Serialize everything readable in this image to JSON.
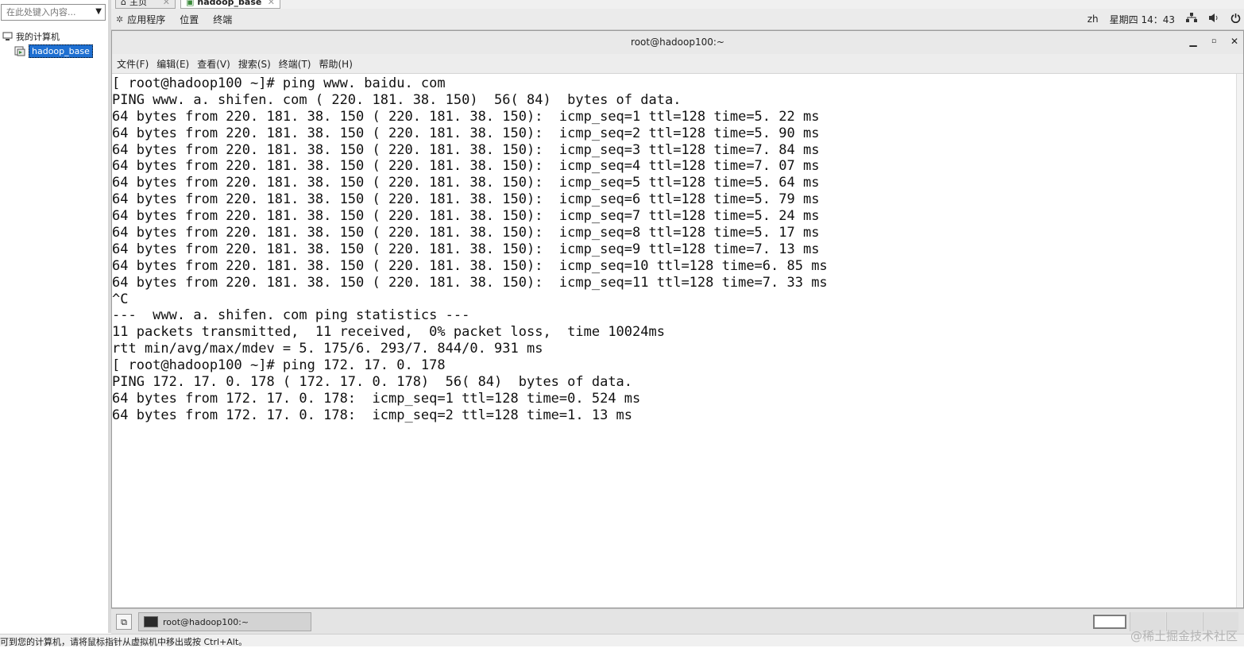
{
  "library": {
    "search_placeholder": "在此处键入内容...",
    "tree": [
      {
        "label": "我的计算机"
      },
      {
        "label": "hadoop_base"
      }
    ]
  },
  "vm_tabs": [
    {
      "label": "主页"
    },
    {
      "label": "hadoop_base"
    }
  ],
  "gnome_panel": {
    "applications": "应用程序",
    "places": "位置",
    "terminal": "终端",
    "input_method": "zh",
    "clock": "星期四 14：43",
    "icons": [
      "network-icon",
      "volume-icon",
      "power-icon"
    ]
  },
  "terminal": {
    "title": "root@hadoop100:~",
    "menu": [
      "文件(F)",
      "编辑(E)",
      "查看(V)",
      "搜索(S)",
      "终端(T)",
      "帮助(H)"
    ],
    "lines": [
      "[ root@hadoop100 ~]# ping www. baidu. com",
      "PING www. a. shifen. com ( 220. 181. 38. 150)  56( 84)  bytes of data.",
      "64 bytes from 220. 181. 38. 150 ( 220. 181. 38. 150):  icmp_seq=1 ttl=128 time=5. 22 ms",
      "64 bytes from 220. 181. 38. 150 ( 220. 181. 38. 150):  icmp_seq=2 ttl=128 time=5. 90 ms",
      "64 bytes from 220. 181. 38. 150 ( 220. 181. 38. 150):  icmp_seq=3 ttl=128 time=7. 84 ms",
      "64 bytes from 220. 181. 38. 150 ( 220. 181. 38. 150):  icmp_seq=4 ttl=128 time=7. 07 ms",
      "64 bytes from 220. 181. 38. 150 ( 220. 181. 38. 150):  icmp_seq=5 ttl=128 time=5. 64 ms",
      "64 bytes from 220. 181. 38. 150 ( 220. 181. 38. 150):  icmp_seq=6 ttl=128 time=5. 79 ms",
      "64 bytes from 220. 181. 38. 150 ( 220. 181. 38. 150):  icmp_seq=7 ttl=128 time=5. 24 ms",
      "64 bytes from 220. 181. 38. 150 ( 220. 181. 38. 150):  icmp_seq=8 ttl=128 time=5. 17 ms",
      "64 bytes from 220. 181. 38. 150 ( 220. 181. 38. 150):  icmp_seq=9 ttl=128 time=7. 13 ms",
      "64 bytes from 220. 181. 38. 150 ( 220. 181. 38. 150):  icmp_seq=10 ttl=128 time=6. 85 ms",
      "64 bytes from 220. 181. 38. 150 ( 220. 181. 38. 150):  icmp_seq=11 ttl=128 time=7. 33 ms",
      "^C",
      "---  www. a. shifen. com ping statistics ---",
      "11 packets transmitted,  11 received,  0% packet loss,  time 10024ms",
      "rtt min/avg/max/mdev = 5. 175/6. 293/7. 844/0. 931 ms",
      "[ root@hadoop100 ~]# ping 172. 17. 0. 178",
      "PING 172. 17. 0. 178 ( 172. 17. 0. 178)  56( 84)  bytes of data.",
      "64 bytes from 172. 17. 0. 178:  icmp_seq=1 ttl=128 time=0. 524 ms",
      "64 bytes from 172. 17. 0. 178:  icmp_seq=2 ttl=128 time=1. 13 ms"
    ]
  },
  "taskbar": {
    "window_button": "root@hadoop100:~"
  },
  "status_bar": {
    "text": "可到您的计算机，请将鼠标指针从虚拟机中移出或按 Ctrl+Alt。",
    "watermark": "@稀土掘金技术社区"
  }
}
